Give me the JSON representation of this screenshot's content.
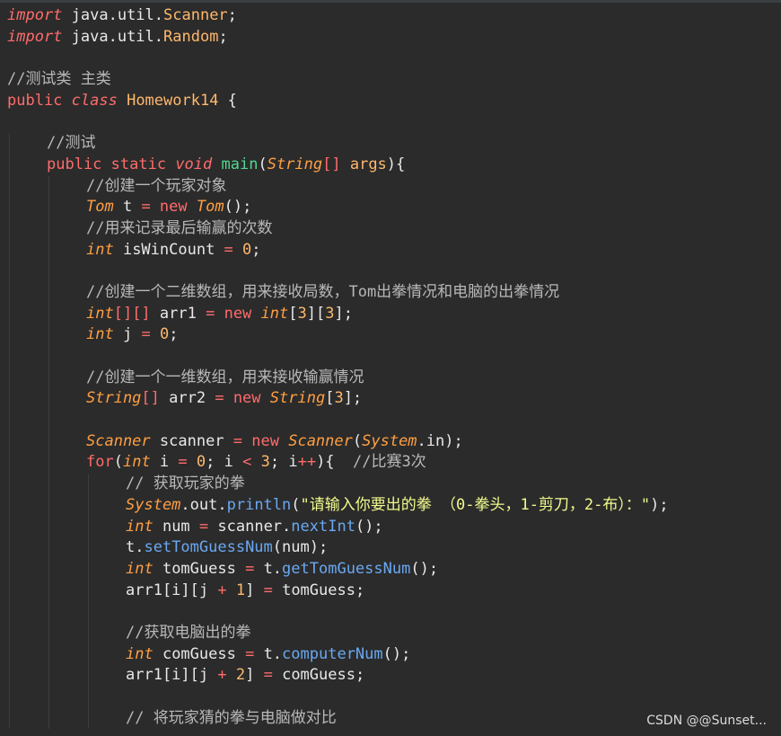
{
  "watermark": "CSDN @@Sunset...",
  "lines": [
    {
      "indent": 0,
      "tokens": [
        [
          "import",
          "c-kwi"
        ],
        [
          " java.util.",
          "c-pkg"
        ],
        [
          "Scanner",
          "c-cls"
        ],
        [
          ";",
          "c-plain"
        ]
      ]
    },
    {
      "indent": 0,
      "tokens": [
        [
          "import",
          "c-kwi"
        ],
        [
          " java.util.",
          "c-pkg"
        ],
        [
          "Random",
          "c-cls"
        ],
        [
          ";",
          "c-plain"
        ]
      ]
    },
    {
      "indent": 0,
      "tokens": []
    },
    {
      "indent": 0,
      "tokens": [
        [
          "//测试类 主类",
          "c-cmt"
        ]
      ]
    },
    {
      "indent": 0,
      "tokens": [
        [
          "public ",
          "c-kw"
        ],
        [
          "class ",
          "c-kwi"
        ],
        [
          "Homework14",
          "c-cls"
        ],
        [
          " {",
          "c-plain"
        ]
      ]
    },
    {
      "indent": 0,
      "tokens": []
    },
    {
      "indent": 1,
      "tokens": [
        [
          "//测试",
          "c-cmt"
        ]
      ]
    },
    {
      "indent": 1,
      "tokens": [
        [
          "public ",
          "c-kw"
        ],
        [
          "static ",
          "c-kw"
        ],
        [
          "void ",
          "c-kwi"
        ],
        [
          "main",
          "c-fn"
        ],
        [
          "(",
          "c-plain"
        ],
        [
          "String",
          "c-typei"
        ],
        [
          "[] ",
          "c-op"
        ],
        [
          "args",
          "c-var"
        ],
        [
          "){",
          "c-plain"
        ]
      ]
    },
    {
      "indent": 2,
      "tokens": [
        [
          "//创建一个玩家对象",
          "c-cmt"
        ]
      ]
    },
    {
      "indent": 2,
      "tokens": [
        [
          "Tom",
          "c-typei"
        ],
        [
          " t ",
          "c-plain"
        ],
        [
          "=",
          "c-op"
        ],
        [
          " new ",
          "c-kw"
        ],
        [
          "Tom",
          "c-typei"
        ],
        [
          "();",
          "c-plain"
        ]
      ]
    },
    {
      "indent": 2,
      "tokens": [
        [
          "//用来记录最后输赢的次数",
          "c-cmt"
        ]
      ]
    },
    {
      "indent": 2,
      "tokens": [
        [
          "int",
          "c-typei"
        ],
        [
          " isWinCount ",
          "c-plain"
        ],
        [
          "=",
          "c-op"
        ],
        [
          " ",
          "c-plain"
        ],
        [
          "0",
          "c-num"
        ],
        [
          ";",
          "c-plain"
        ]
      ]
    },
    {
      "indent": 2,
      "tokens": []
    },
    {
      "indent": 2,
      "tokens": [
        [
          "//创建一个二维数组，用来接收局数，Tom出拳情况和电脑的出拳情况",
          "c-cmt"
        ]
      ]
    },
    {
      "indent": 2,
      "tokens": [
        [
          "int",
          "c-typei"
        ],
        [
          "[][]",
          "c-op"
        ],
        [
          " arr1 ",
          "c-plain"
        ],
        [
          "=",
          "c-op"
        ],
        [
          " new ",
          "c-kw"
        ],
        [
          "int",
          "c-typei"
        ],
        [
          "[",
          "c-plain"
        ],
        [
          "3",
          "c-num"
        ],
        [
          "][",
          "c-plain"
        ],
        [
          "3",
          "c-num"
        ],
        [
          "];",
          "c-plain"
        ]
      ]
    },
    {
      "indent": 2,
      "tokens": [
        [
          "int",
          "c-typei"
        ],
        [
          " j ",
          "c-plain"
        ],
        [
          "=",
          "c-op"
        ],
        [
          " ",
          "c-plain"
        ],
        [
          "0",
          "c-num"
        ],
        [
          ";",
          "c-plain"
        ]
      ]
    },
    {
      "indent": 2,
      "tokens": []
    },
    {
      "indent": 2,
      "tokens": [
        [
          "//创建一个一维数组，用来接收输赢情况",
          "c-cmt"
        ]
      ]
    },
    {
      "indent": 2,
      "tokens": [
        [
          "String",
          "c-typei"
        ],
        [
          "[]",
          "c-op"
        ],
        [
          " arr2 ",
          "c-plain"
        ],
        [
          "=",
          "c-op"
        ],
        [
          " new ",
          "c-kw"
        ],
        [
          "String",
          "c-typei"
        ],
        [
          "[",
          "c-plain"
        ],
        [
          "3",
          "c-num"
        ],
        [
          "];",
          "c-plain"
        ]
      ]
    },
    {
      "indent": 2,
      "tokens": []
    },
    {
      "indent": 2,
      "tokens": [
        [
          "Scanner",
          "c-typei"
        ],
        [
          " scanner ",
          "c-plain"
        ],
        [
          "=",
          "c-op"
        ],
        [
          " new ",
          "c-kw"
        ],
        [
          "Scanner",
          "c-typei"
        ],
        [
          "(",
          "c-plain"
        ],
        [
          "System",
          "c-typei"
        ],
        [
          ".in);",
          "c-plain"
        ]
      ]
    },
    {
      "indent": 2,
      "tokens": [
        [
          "for",
          "c-kw"
        ],
        [
          "(",
          "c-plain"
        ],
        [
          "int",
          "c-typei"
        ],
        [
          " i ",
          "c-plain"
        ],
        [
          "=",
          "c-op"
        ],
        [
          " ",
          "c-plain"
        ],
        [
          "0",
          "c-num"
        ],
        [
          "; i ",
          "c-plain"
        ],
        [
          "<",
          "c-op"
        ],
        [
          " ",
          "c-plain"
        ],
        [
          "3",
          "c-num"
        ],
        [
          "; i",
          "c-plain"
        ],
        [
          "++",
          "c-op"
        ],
        [
          "){  ",
          "c-plain"
        ],
        [
          "//比赛3次",
          "c-cmt"
        ]
      ]
    },
    {
      "indent": 3,
      "tokens": [
        [
          "// 获取玩家的拳",
          "c-cmt"
        ]
      ]
    },
    {
      "indent": 3,
      "tokens": [
        [
          "System",
          "c-typei"
        ],
        [
          ".out.",
          "c-plain"
        ],
        [
          "println",
          "c-mth"
        ],
        [
          "(",
          "c-plain"
        ],
        [
          "\"请输入你要出的拳 （0-拳头，1-剪刀，2-布）：\"",
          "c-str"
        ],
        [
          ");",
          "c-plain"
        ]
      ]
    },
    {
      "indent": 3,
      "tokens": [
        [
          "int",
          "c-typei"
        ],
        [
          " num ",
          "c-plain"
        ],
        [
          "=",
          "c-op"
        ],
        [
          " scanner.",
          "c-plain"
        ],
        [
          "nextInt",
          "c-mth"
        ],
        [
          "();",
          "c-plain"
        ]
      ]
    },
    {
      "indent": 3,
      "tokens": [
        [
          "t.",
          "c-plain"
        ],
        [
          "setTomGuessNum",
          "c-mth"
        ],
        [
          "(num);",
          "c-plain"
        ]
      ]
    },
    {
      "indent": 3,
      "tokens": [
        [
          "int",
          "c-typei"
        ],
        [
          " tomGuess ",
          "c-plain"
        ],
        [
          "=",
          "c-op"
        ],
        [
          " t.",
          "c-plain"
        ],
        [
          "getTomGuessNum",
          "c-mth"
        ],
        [
          "();",
          "c-plain"
        ]
      ]
    },
    {
      "indent": 3,
      "tokens": [
        [
          "arr1[i][j ",
          "c-plain"
        ],
        [
          "+",
          "c-op"
        ],
        [
          " ",
          "c-plain"
        ],
        [
          "1",
          "c-num"
        ],
        [
          "] ",
          "c-plain"
        ],
        [
          "=",
          "c-op"
        ],
        [
          " tomGuess;",
          "c-plain"
        ]
      ]
    },
    {
      "indent": 3,
      "tokens": []
    },
    {
      "indent": 3,
      "tokens": [
        [
          "//获取电脑出的拳",
          "c-cmt"
        ]
      ]
    },
    {
      "indent": 3,
      "tokens": [
        [
          "int",
          "c-typei"
        ],
        [
          " comGuess ",
          "c-plain"
        ],
        [
          "=",
          "c-op"
        ],
        [
          " t.",
          "c-plain"
        ],
        [
          "computerNum",
          "c-mth"
        ],
        [
          "();",
          "c-plain"
        ]
      ]
    },
    {
      "indent": 3,
      "tokens": [
        [
          "arr1[i][j ",
          "c-plain"
        ],
        [
          "+",
          "c-op"
        ],
        [
          " ",
          "c-plain"
        ],
        [
          "2",
          "c-num"
        ],
        [
          "] ",
          "c-plain"
        ],
        [
          "=",
          "c-op"
        ],
        [
          " comGuess;",
          "c-plain"
        ]
      ]
    },
    {
      "indent": 3,
      "tokens": []
    },
    {
      "indent": 3,
      "tokens": [
        [
          "// 将玩家猜的拳与电脑做对比",
          "c-cmt"
        ]
      ]
    }
  ]
}
